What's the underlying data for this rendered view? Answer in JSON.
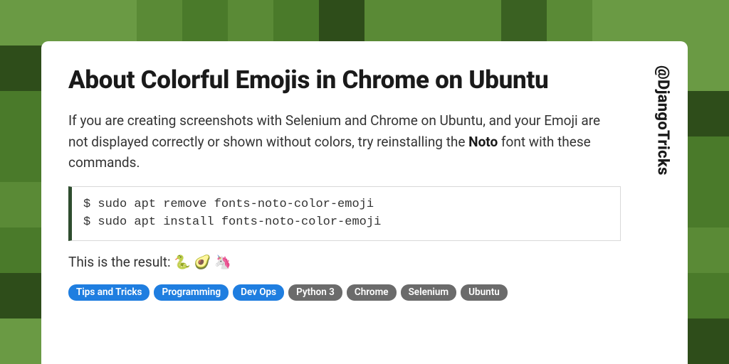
{
  "title": "About Colorful Emojis in Chrome on Ubuntu",
  "intro": {
    "pre": "If you are creating screenshots with Selenium and Chrome on Ubuntu, and your Emoji are not displayed correctly or shown without colors, try reinstalling the ",
    "strong": "Noto",
    "post": " font with these commands."
  },
  "code": "$ sudo apt remove fonts-noto-color-emoji\n$ sudo apt install fonts-noto-color-emoji",
  "result_label": "This is the result: ",
  "result_emojis": "🐍 🥑 🦄",
  "tags": [
    {
      "label": "Tips and Tricks",
      "color": "blue"
    },
    {
      "label": "Programming",
      "color": "blue"
    },
    {
      "label": "Dev Ops",
      "color": "blue"
    },
    {
      "label": "Python 3",
      "color": "gray"
    },
    {
      "label": "Chrome",
      "color": "gray"
    },
    {
      "label": "Selenium",
      "color": "gray"
    },
    {
      "label": "Ubuntu",
      "color": "gray"
    }
  ],
  "handle": "@DjangoTricks"
}
